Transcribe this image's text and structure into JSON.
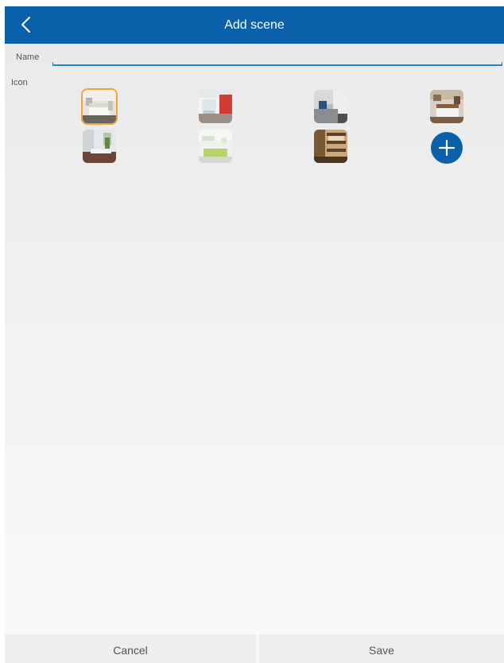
{
  "header": {
    "title": "Add scene",
    "back_icon": "chevron-left-icon"
  },
  "form": {
    "name_label": "Name",
    "name_value": "",
    "icon_label": "Icon"
  },
  "icons": [
    {
      "name": "bedroom-scene-icon",
      "selected": true
    },
    {
      "name": "kitchen-scene-icon",
      "selected": false
    },
    {
      "name": "office-scene-icon",
      "selected": false
    },
    {
      "name": "bedroom-2-scene-icon",
      "selected": false
    },
    {
      "name": "bathroom-scene-icon",
      "selected": false
    },
    {
      "name": "living-room-scene-icon",
      "selected": false
    },
    {
      "name": "study-scene-icon",
      "selected": false
    }
  ],
  "add_icon": "plus-icon",
  "footer": {
    "cancel_label": "Cancel",
    "save_label": "Save"
  },
  "colors": {
    "accent": "#0b61a9",
    "input_underline": "#1e88c8",
    "selected_outline": "#f2a43a"
  }
}
